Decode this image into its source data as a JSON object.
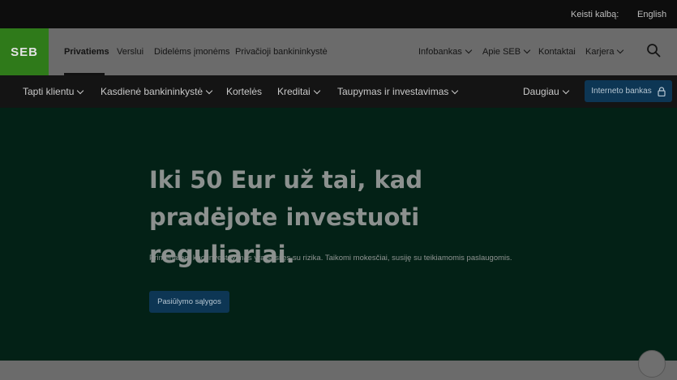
{
  "language_bar": {
    "label": "Keisti kalbą:",
    "link": "English"
  },
  "logo": {
    "text": "SEB"
  },
  "main_nav": {
    "left": [
      "Privatiems",
      "Verslui",
      "Didelėms įmonėms",
      "Privačioji bankininkystė"
    ],
    "right": [
      "Infobankas",
      "Apie SEB",
      "Kontaktai",
      "Karjera"
    ]
  },
  "sub_nav": {
    "items": [
      "Tapti klientu",
      "Kasdienė bankininkystė",
      "Kortelės",
      "Kreditai",
      "Taupymas ir investavimas"
    ],
    "more": "Daugiau",
    "internet_bank": "Interneto bankas"
  },
  "hero": {
    "title": "Iki 50 Eur už tai, kad pradėjote investuoti reguliariai.",
    "note": "Primename, kad investavimas yra susijęs su rizika. Taikomi mokesčiai, susiję su teikiamomis paslaugomis.",
    "button": "Pasiūlymo sąlygos"
  },
  "icons": {
    "search": "search-icon",
    "lock": "lock-icon",
    "chevron": "chevron-down-icon"
  }
}
